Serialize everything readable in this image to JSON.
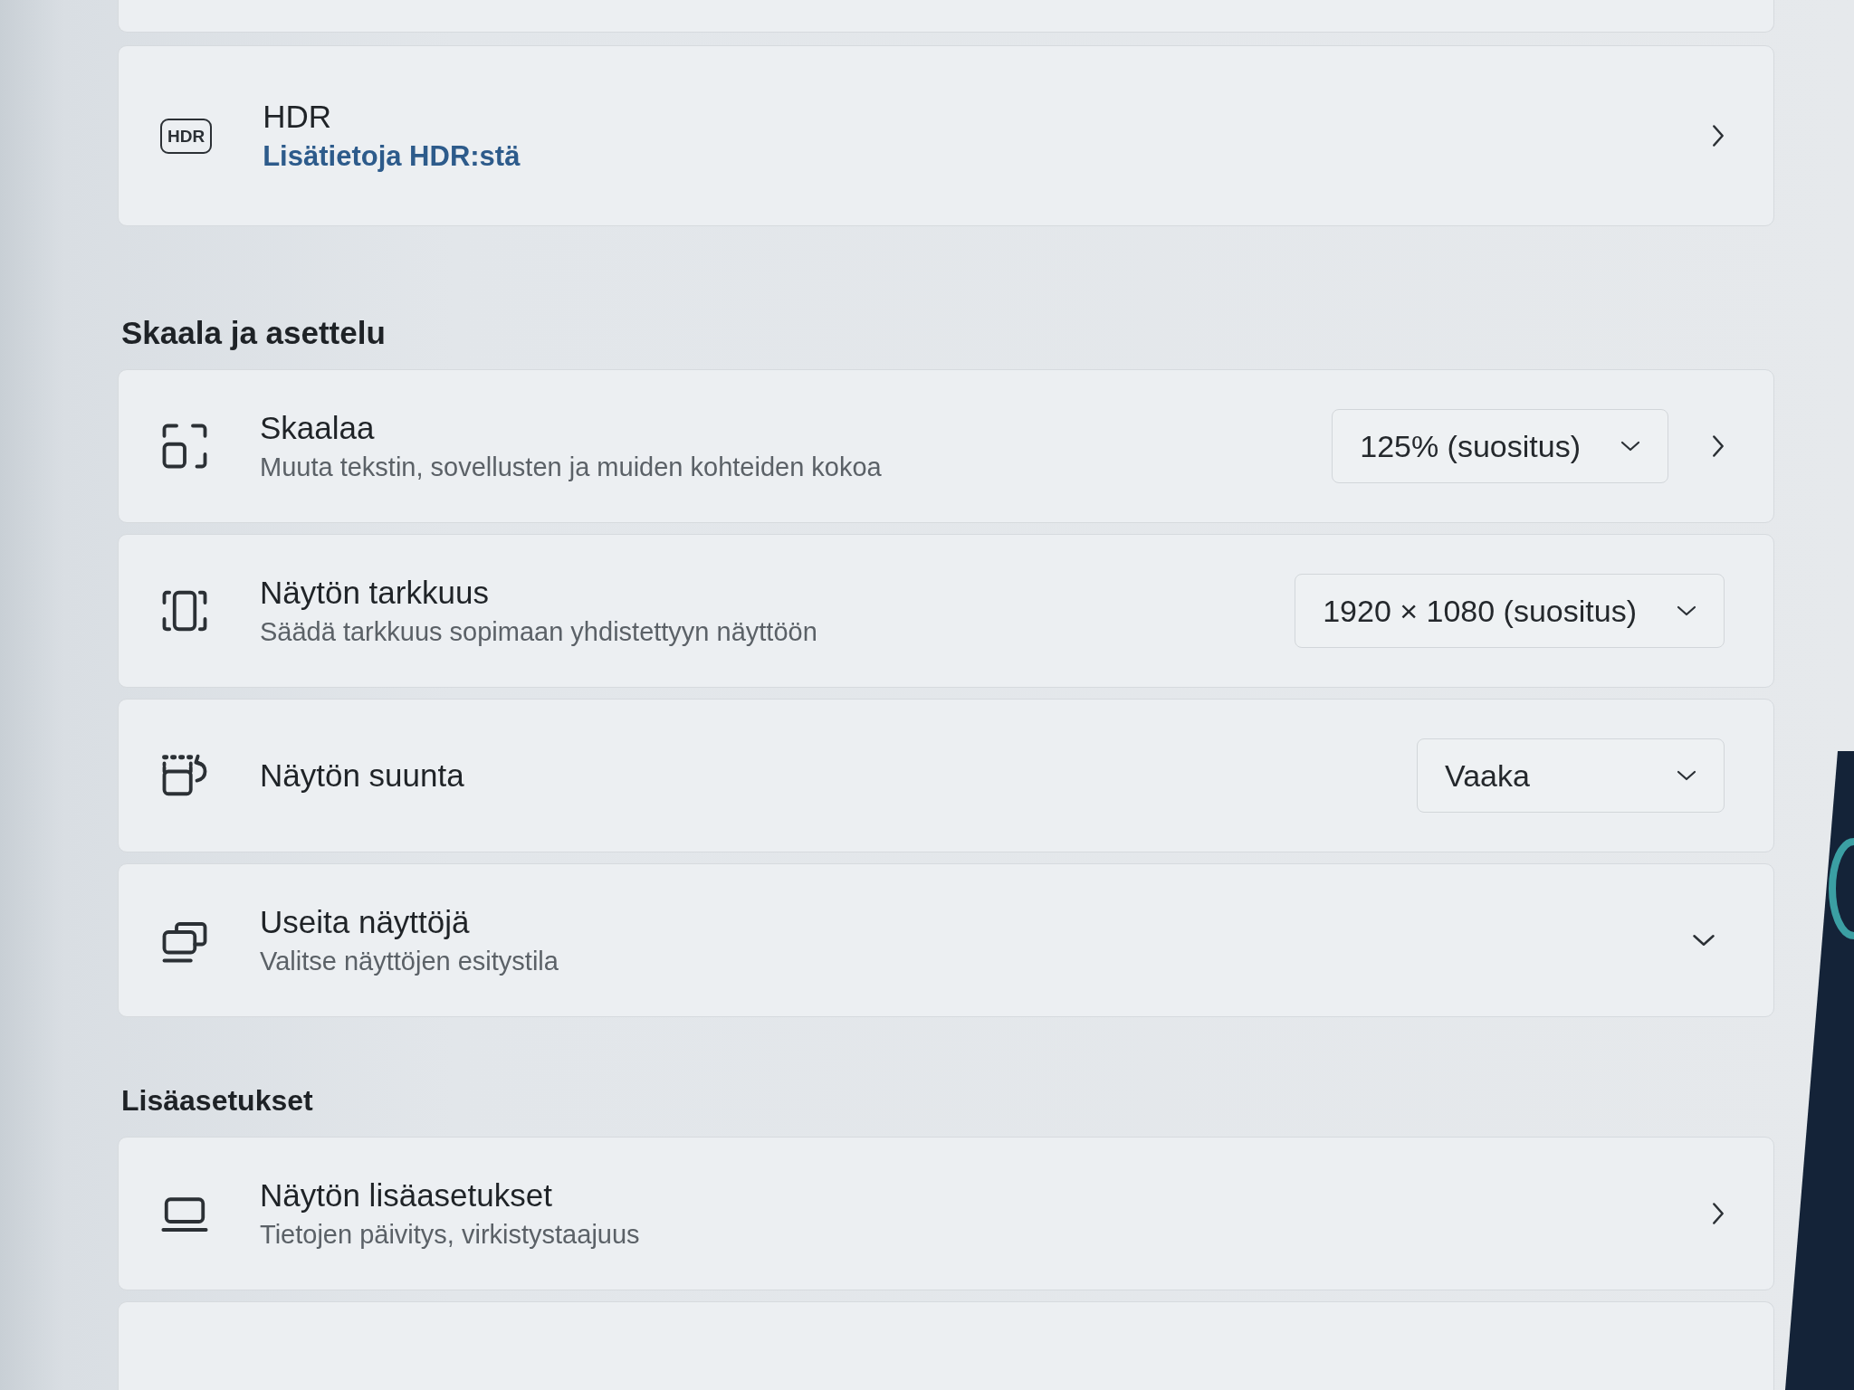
{
  "groups": [
    {
      "rows": [
        {
          "kind": "cut_off"
        },
        {
          "kind": "nav",
          "badge": "HDR",
          "title": "HDR",
          "link": "Lisätietoja HDR:stä"
        }
      ]
    },
    {
      "heading": "Skaala ja asettelu",
      "rows": [
        {
          "kind": "dropdown_nav",
          "title": "Skaalaa",
          "subtitle": "Muuta tekstin, sovellusten ja muiden kohteiden kokoa",
          "value": "125% (suositus)"
        },
        {
          "kind": "dropdown",
          "title": "Näytön tarkkuus",
          "subtitle": "Säädä tarkkuus sopimaan yhdistettyyn näyttöön",
          "value": "1920 × 1080 (suositus)"
        },
        {
          "kind": "dropdown",
          "title": "Näytön suunta",
          "value": "Vaaka"
        },
        {
          "kind": "expander",
          "title": "Useita näyttöjä",
          "subtitle": "Valitse näyttöjen esitystila",
          "expanded": false
        }
      ]
    },
    {
      "heading": "Lisäasetukset",
      "rows": [
        {
          "kind": "nav",
          "title": "Näytön lisäasetukset",
          "subtitle": "Tietojen päivitys, virkistystaajuus"
        },
        {
          "kind": "cut_off"
        }
      ]
    }
  ]
}
